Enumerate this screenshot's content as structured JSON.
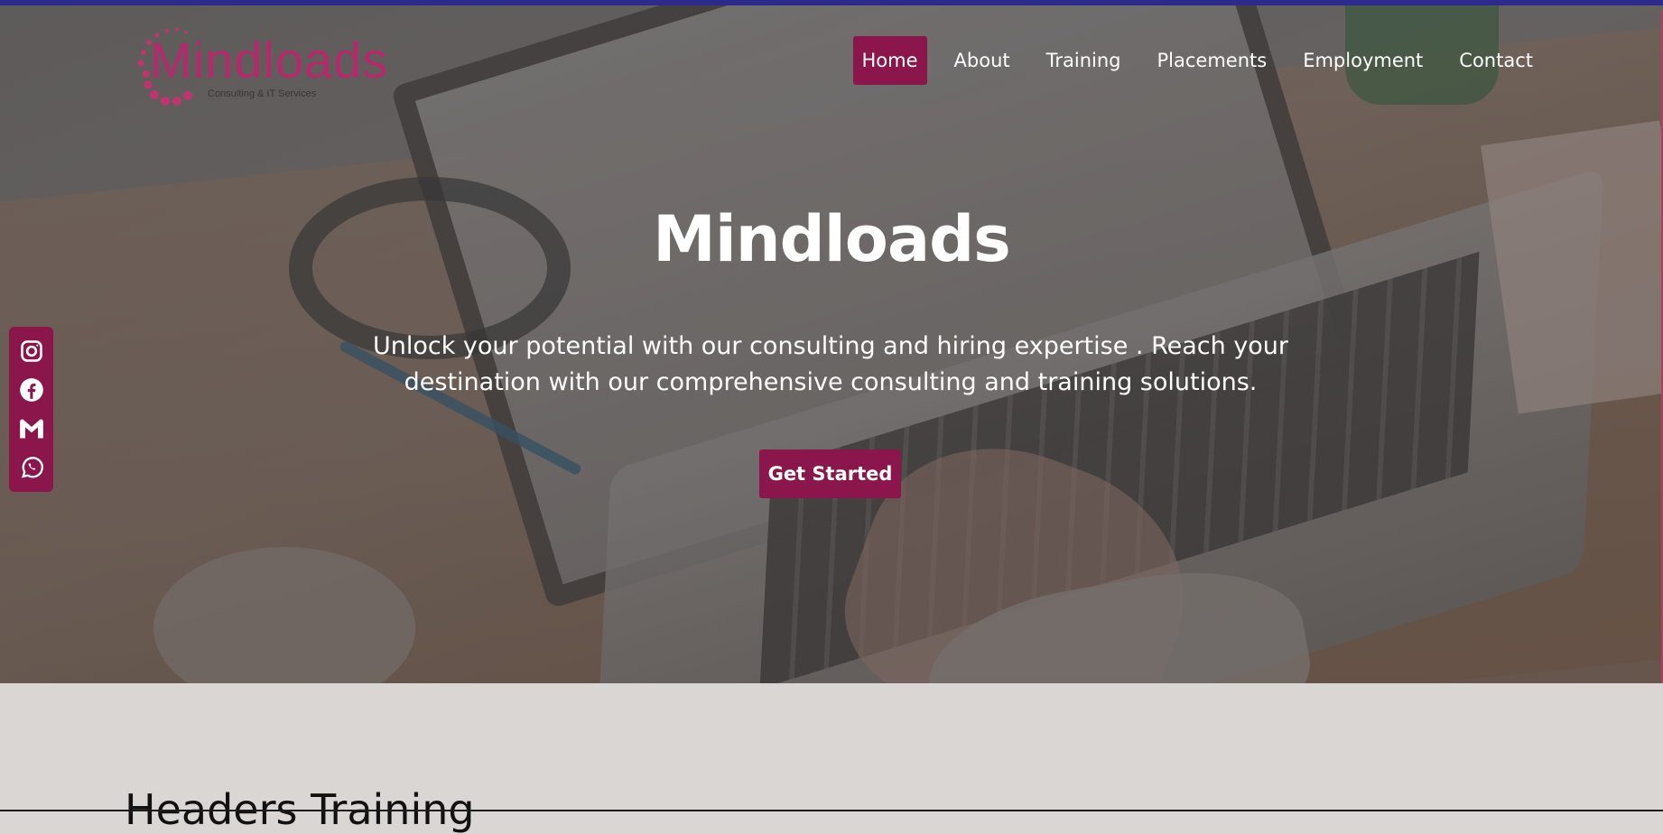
{
  "brand": {
    "logo_text": "Mindloads",
    "logo_sub": "Consulting & IT Services",
    "primary_color": "#8a164b",
    "logo_color": "#b42a6b"
  },
  "nav": {
    "items": [
      {
        "label": "Home",
        "active": true
      },
      {
        "label": "About",
        "active": false
      },
      {
        "label": "Training",
        "active": false
      },
      {
        "label": "Placements",
        "active": false
      },
      {
        "label": "Employment",
        "active": false
      },
      {
        "label": "Contact",
        "active": false
      }
    ]
  },
  "hero": {
    "title": "Mindloads",
    "subtitle": "Unlock your potential with our consulting and hiring expertise . Reach your destination with our comprehensive consulting and training solutions.",
    "cta_label": "Get Started"
  },
  "social": {
    "icons": [
      "instagram-icon",
      "facebook-icon",
      "gmail-icon",
      "whatsapp-icon"
    ]
  },
  "next_section": {
    "heading_partial": "Headers Training"
  }
}
